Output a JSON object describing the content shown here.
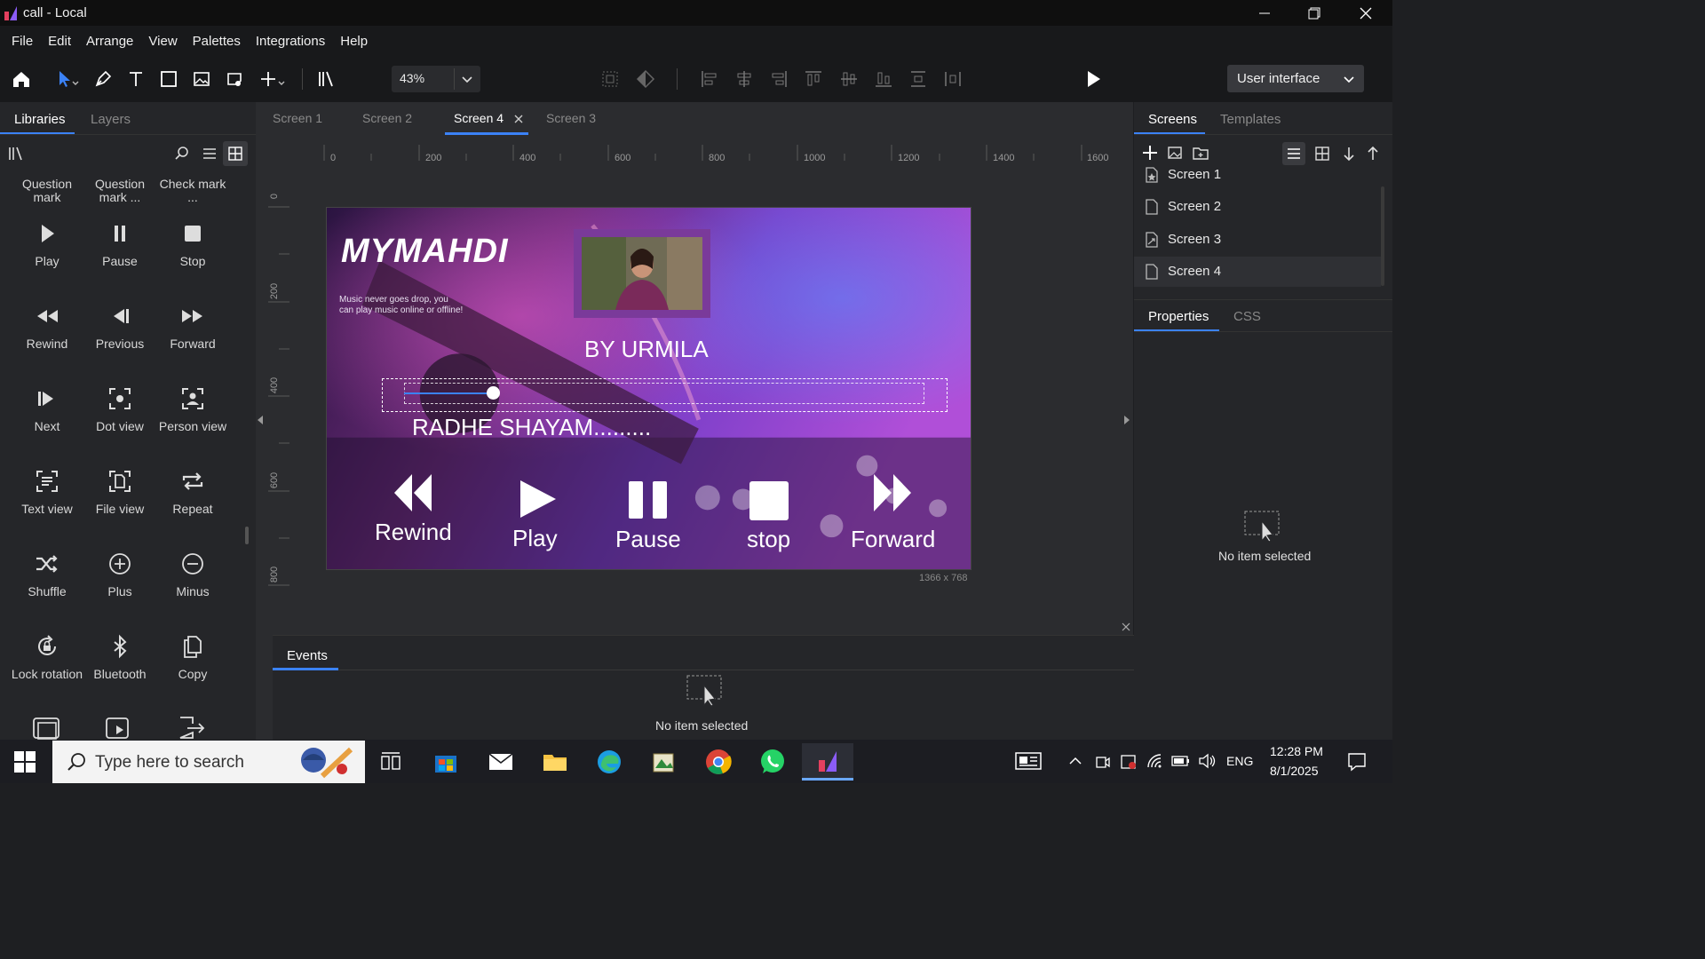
{
  "window": {
    "title": "call - Local"
  },
  "menu": [
    "File",
    "Edit",
    "Arrange",
    "View",
    "Palettes",
    "Integrations",
    "Help"
  ],
  "toolbar": {
    "zoom": "43%",
    "mode": "User interface"
  },
  "left_panel": {
    "tabs": [
      "Libraries",
      "Layers"
    ],
    "items": [
      {
        "label": "Question mark",
        "icon": "question-mark-icon"
      },
      {
        "label": "Question mark ...",
        "icon": "question-mark-icon"
      },
      {
        "label": "Check mark ...",
        "icon": "check-mark-icon"
      },
      {
        "label": "Play",
        "icon": "play-icon"
      },
      {
        "label": "Pause",
        "icon": "pause-icon"
      },
      {
        "label": "Stop",
        "icon": "stop-icon"
      },
      {
        "label": "Rewind",
        "icon": "rewind-icon"
      },
      {
        "label": "Previous",
        "icon": "previous-icon"
      },
      {
        "label": "Forward",
        "icon": "forward-icon"
      },
      {
        "label": "Next",
        "icon": "next-icon"
      },
      {
        "label": "Dot view",
        "icon": "dot-view-icon"
      },
      {
        "label": "Person view",
        "icon": "person-view-icon"
      },
      {
        "label": "Text view",
        "icon": "text-view-icon"
      },
      {
        "label": "File view",
        "icon": "file-view-icon"
      },
      {
        "label": "Repeat",
        "icon": "repeat-icon"
      },
      {
        "label": "Shuffle",
        "icon": "shuffle-icon"
      },
      {
        "label": "Plus",
        "icon": "plus-icon"
      },
      {
        "label": "Minus",
        "icon": "minus-icon"
      },
      {
        "label": "Lock rotation",
        "icon": "lock-rotation-icon"
      },
      {
        "label": "Bluetooth",
        "icon": "bluetooth-icon"
      },
      {
        "label": "Copy",
        "icon": "copy-icon"
      }
    ]
  },
  "screen_tabs": [
    "Screen 1",
    "Screen 2",
    "Screen 4",
    "Screen 3"
  ],
  "active_screen_tab": "Screen 4",
  "rulers": {
    "h": [
      "0",
      "200",
      "400",
      "600",
      "800",
      "1000",
      "1200",
      "1400",
      "1600"
    ],
    "v": [
      "0",
      "200",
      "400",
      "600",
      "800"
    ]
  },
  "artboard": {
    "logo": "MYMAHDI",
    "tagline": "Music never goes drop, you can play music online or offline!",
    "by": "BY URMILA",
    "song": "RADHE SHAYAM.........",
    "progress": 0.17,
    "controls": [
      "Rewind",
      "Play",
      "Pause",
      "stop",
      "Forward"
    ],
    "size": "1366 x 768"
  },
  "events": {
    "tab": "Events",
    "empty": "No item selected"
  },
  "right_panel": {
    "tabs": [
      "Screens",
      "Templates"
    ],
    "screens": [
      "Screen 1",
      "Screen 2",
      "Screen 3",
      "Screen 4"
    ],
    "prop_tabs": [
      "Properties",
      "CSS"
    ],
    "empty": "No item selected"
  },
  "taskbar": {
    "search_placeholder": "Type here to search",
    "language": "ENG",
    "time": "12:28 PM",
    "date": "8/1/2025"
  },
  "colors": {
    "accent": "#3b82f6",
    "bg": "#1e1f22"
  }
}
